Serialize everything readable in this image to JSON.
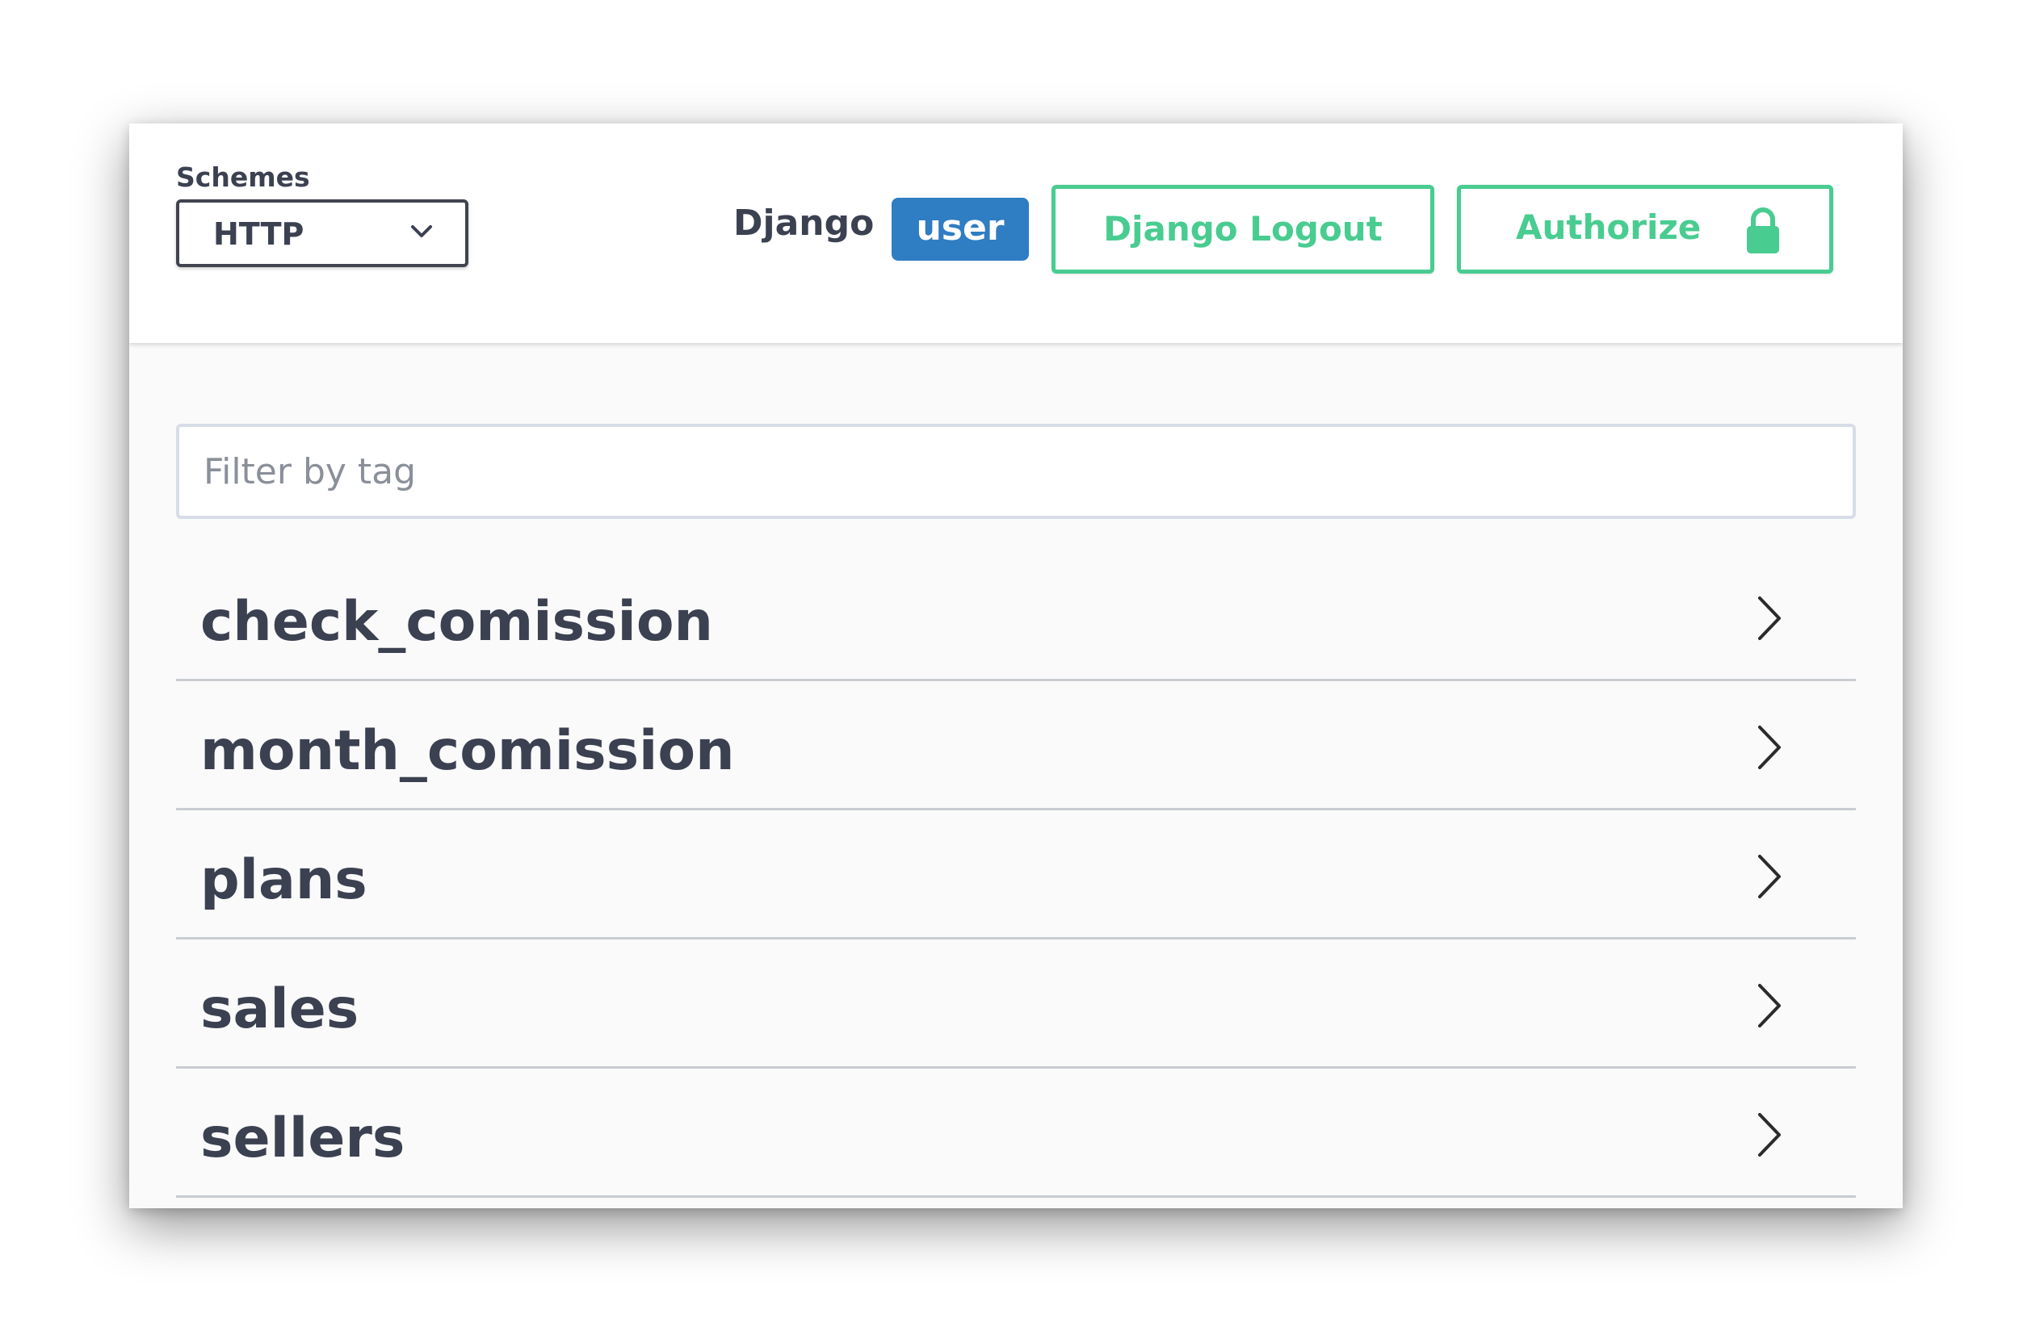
{
  "header": {
    "schemes_label": "Schemes",
    "scheme_selected": "HTTP",
    "django_label": "Django",
    "user_badge": "user",
    "logout_label": "Django Logout",
    "authorize_label": "Authorize"
  },
  "filter": {
    "placeholder": "Filter by tag",
    "value": ""
  },
  "tags": [
    {
      "label": "check_comission"
    },
    {
      "label": "month_comission"
    },
    {
      "label": "plans"
    },
    {
      "label": "sales"
    },
    {
      "label": "sellers"
    }
  ],
  "colors": {
    "accent_green": "#49cc90",
    "badge_blue": "#2f7dc2",
    "text_dark": "#3b4151"
  },
  "icons": {
    "select_chevron": "chevron-down-icon",
    "authorize": "lock-icon",
    "tag_expand": "chevron-right-icon"
  }
}
